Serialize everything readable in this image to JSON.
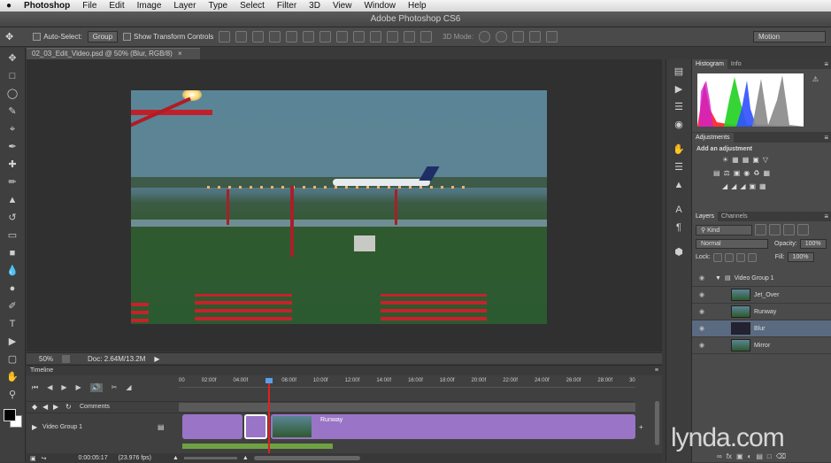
{
  "menubar": {
    "apple": "",
    "items": [
      "Photoshop",
      "File",
      "Edit",
      "Image",
      "Layer",
      "Type",
      "Select",
      "Filter",
      "3D",
      "View",
      "Window",
      "Help"
    ]
  },
  "window_title": "Adobe Photoshop CS6",
  "options_bar": {
    "auto_select_label": "Auto-Select:",
    "auto_select_value": "Group",
    "show_transform_label": "Show Transform Controls",
    "mode_3d_label": "3D Mode:",
    "workspace": "Motion"
  },
  "document_tab": "02_03_Edit_Video.psd @ 50% (Blur, RGB/8)",
  "status": {
    "zoom": "50%",
    "doc": "Doc: 2.64M/13.2M"
  },
  "panels": {
    "histogram_tabs": [
      "Histogram",
      "Info"
    ],
    "adjustments_tab": "Adjustments",
    "adjustments_title": "Add an adjustment",
    "layers_tabs": [
      "Layers",
      "Channels"
    ],
    "layers_filter": "Kind",
    "blend_mode": "Normal",
    "opacity_label": "Opacity:",
    "opacity_value": "100%",
    "lock_label": "Lock:",
    "fill_label": "Fill:",
    "fill_value": "100%",
    "layers": [
      {
        "name": "Video Group 1",
        "type": "group"
      },
      {
        "name": "Jet_Over",
        "type": "layer"
      },
      {
        "name": "Runway",
        "type": "layer"
      },
      {
        "name": "Blur",
        "type": "layer",
        "selected": true
      },
      {
        "name": "Mirror",
        "type": "layer"
      }
    ]
  },
  "timeline": {
    "title": "Timeline",
    "ruler": [
      "00",
      "02:00f",
      "04:00f",
      "",
      "08:00f",
      "10:00f",
      "12:00f",
      "14:00f",
      "16:00f",
      "18:00f",
      "20:00f",
      "22:00f",
      "24:00f",
      "26:00f",
      "28:00f",
      "30"
    ],
    "comments_label": "Comments",
    "video_group_label": "Video Group 1",
    "clip_label": "Runway",
    "timecode": "0:00:05:17",
    "fps": "(23.976 fps)"
  },
  "watermark": "lynda.com"
}
